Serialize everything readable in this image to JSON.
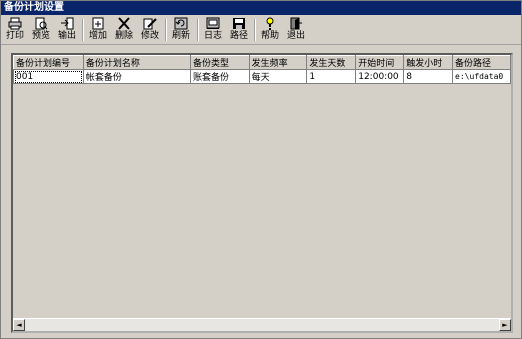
{
  "window": {
    "title": "备份计划设置"
  },
  "toolbar": {
    "print": "打印",
    "preview": "预览",
    "export": "输出",
    "add": "增加",
    "delete": "删除",
    "modify": "修改",
    "refresh": "刷新",
    "log": "日志",
    "path": "路径",
    "help": "帮助",
    "exit": "退出"
  },
  "grid": {
    "headers": [
      "备份计划编号",
      "备份计划名称",
      "备份类型",
      "发生频率",
      "发生天数",
      "开始时间",
      "触发小时",
      "备份路径"
    ],
    "rows": [
      [
        "001",
        "帐套备份",
        "账套备份",
        "每天",
        "1",
        "12:00:00",
        "8",
        "e:\\ufdata0"
      ]
    ]
  },
  "scrollbar": {
    "left_arrow": "◄",
    "right_arrow": "►"
  }
}
